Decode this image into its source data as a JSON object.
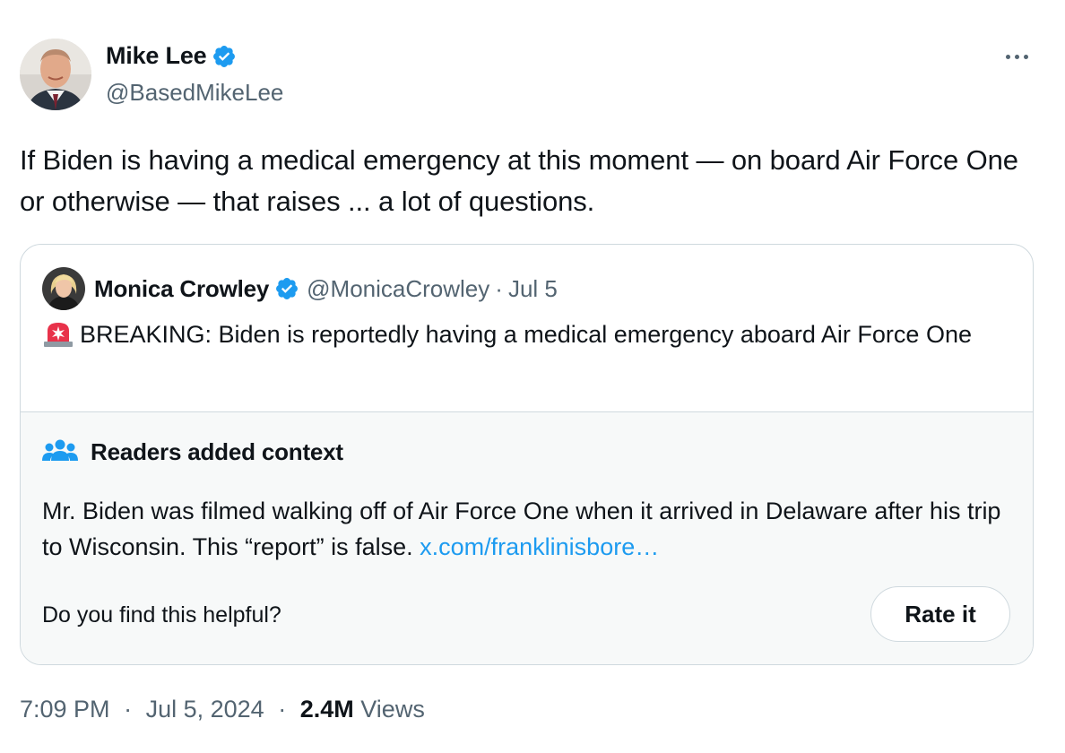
{
  "author": {
    "name": "Mike Lee",
    "handle": "@BasedMikeLee",
    "verified": true
  },
  "more_icon": "more-horizontal-icon",
  "tweet": {
    "text": "If Biden is having a medical emergency at this moment — on board Air Force One or otherwise — that raises ... a lot of questions."
  },
  "quoted": {
    "name": "Monica Crowley",
    "handle": "@MonicaCrowley",
    "separator": "·",
    "date": "Jul 5",
    "emoji_icon": "police-siren-icon",
    "text": "BREAKING: Biden is reportedly having a medical emergency aboard Air Force One"
  },
  "context": {
    "icon": "people-icon",
    "title": "Readers added context",
    "body": "Mr. Biden was filmed walking off of Air Force One when it arrived in Delaware after his trip to Wisconsin. This “report” is false. ",
    "link_text": "x.com/franklinisbore…",
    "question": "Do you find this helpful?",
    "button_label": "Rate it"
  },
  "meta": {
    "time": "7:09 PM",
    "sep1": "·",
    "date": "Jul 5, 2024",
    "sep2": "·",
    "views_count": "2.4M",
    "views_label": "Views"
  },
  "colors": {
    "text": "#0f1419",
    "secondary": "#536471",
    "link": "#1d9bf0",
    "verified": "#1d9bf0",
    "border": "#cfd9de",
    "context_bg": "#f7f9f9"
  }
}
